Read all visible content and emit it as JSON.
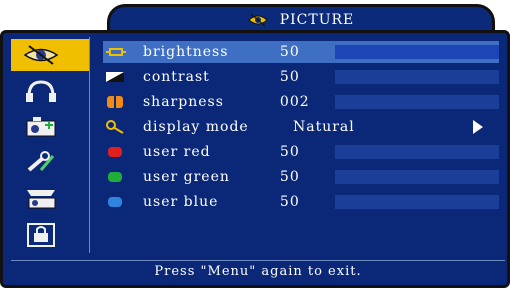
{
  "header": {
    "title": "PICTURE",
    "icon": "picture-eye-icon"
  },
  "sidebar": {
    "items": [
      {
        "name": "picture-menu",
        "icon": "picture-eye-icon",
        "active": true
      },
      {
        "name": "audio-menu",
        "icon": "headphones-icon",
        "active": false
      },
      {
        "name": "setup-menu",
        "icon": "camera-plus-icon",
        "active": false
      },
      {
        "name": "tools-menu",
        "icon": "tools-icon",
        "active": false
      },
      {
        "name": "projector-menu",
        "icon": "projector-icon",
        "active": false
      },
      {
        "name": "lock-menu",
        "icon": "lock-icon",
        "active": false
      }
    ]
  },
  "menu": {
    "rows": [
      {
        "label": "brightness",
        "value": "50",
        "icon": "brightness-icon",
        "selected": true,
        "bar": true
      },
      {
        "label": "contrast",
        "value": "50",
        "icon": "contrast-icon",
        "selected": false,
        "bar": true
      },
      {
        "label": "sharpness",
        "value": "002",
        "icon": "sharpness-icon",
        "selected": false,
        "bar": true
      },
      {
        "label": "display mode",
        "value": "Natural",
        "icon": "display-mode-icon",
        "selected": false,
        "bar": false
      },
      {
        "label": "user red",
        "value": "50",
        "icon": "red-channel-icon",
        "selected": false,
        "bar": true
      },
      {
        "label": "user green",
        "value": "50",
        "icon": "green-channel-icon",
        "selected": false,
        "bar": true
      },
      {
        "label": "user blue",
        "value": "50",
        "icon": "blue-channel-icon",
        "selected": false,
        "bar": true
      }
    ]
  },
  "footer": {
    "hint": "Press \"Menu\" again to exit."
  },
  "colors": {
    "panel": "#0a2877",
    "highlight": "#3f6fc2",
    "active_sidebar": "#f0c000",
    "red": "#e0201e",
    "green": "#1fae3a",
    "blue": "#2f84e0"
  }
}
